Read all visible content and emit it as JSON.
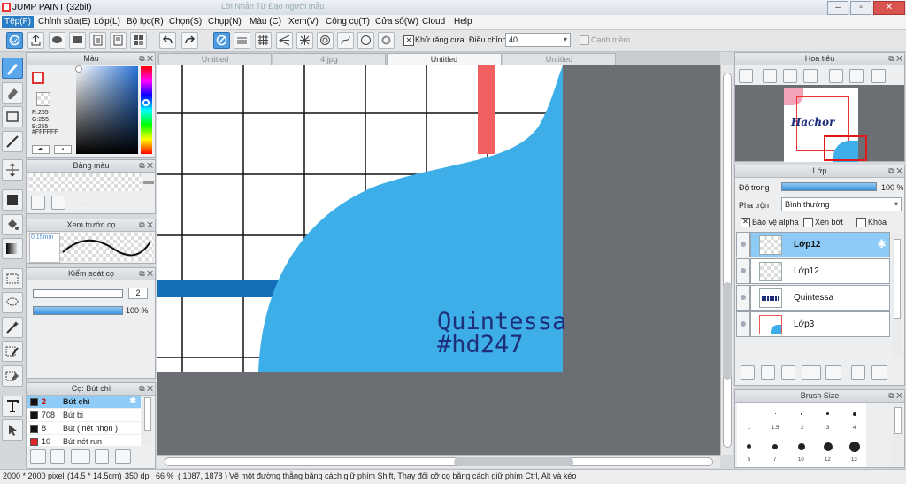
{
  "window": {
    "title": "JUMP PAINT (32bit)",
    "bg_tab_text": "Lời Nhắn Từ Đạo người mẫu"
  },
  "menu": [
    "Tệp(F)",
    "Chỉnh sửa(E)",
    "Lớp(L)",
    "Bộ lọc(R)",
    "Chọn(S)",
    "Chụp(N)",
    "Màu (C)",
    "Xem(V)",
    "Công cụ(T)",
    "Cửa sổ(W)",
    "Cloud",
    "Help"
  ],
  "toolbar": {
    "antialias_label": "Khử răng cưa",
    "correction_label": "Điều chỉnh",
    "correction_value": "40",
    "soft_label": "Cạnh mềm"
  },
  "color_panel": {
    "title": "Màu",
    "r": "R:255",
    "g": "G:255",
    "b": "B:255",
    "hex": "#FFFFFF"
  },
  "palette_panel": {
    "title": "Bảng màu",
    "empty": "---"
  },
  "brush_preview_panel": {
    "title": "Xem trước cọ",
    "size": "0.15mm"
  },
  "brush_control_panel": {
    "title": "Kiểm soát cọ",
    "size_value": "2",
    "opacity_value": "100 %",
    "opacity": 1.0
  },
  "brushes_panel": {
    "title": "Cọ: Bút chì",
    "items": [
      {
        "num": "2",
        "name": "Bút chì",
        "color": "#111111",
        "selected": true
      },
      {
        "num": "708",
        "name": "Bút bi",
        "color": "#111111",
        "selected": false
      },
      {
        "num": "8",
        "name": "Bút ( nét nhọn )",
        "color": "#111111",
        "selected": false
      },
      {
        "num": "10",
        "name": "Bút nét run",
        "color": "#e0242a",
        "selected": false
      }
    ]
  },
  "tabs": [
    "Untitled",
    "4.jpg",
    "Untitled",
    "Untitled"
  ],
  "canvas": {
    "line1": "Quintessa",
    "line2": "#hd247"
  },
  "navigator": {
    "title": "Hoa tiêu",
    "thumb_text": "Hachor"
  },
  "layer_panel": {
    "title": "Lớp",
    "opacity_label": "Độ trong",
    "opacity_value": "100 %",
    "opacity": 1.0,
    "blend_label": "Pha trộn",
    "blend_value": "Bình thường",
    "alpha_label": "Bảo vệ alpha",
    "clip_label": "Xén bớt",
    "lock_label": "Khóa",
    "layers": [
      {
        "name": "Lớp12",
        "selected": true
      },
      {
        "name": "Lớp12",
        "selected": false
      },
      {
        "name": "Quintessa",
        "selected": false
      },
      {
        "name": "Lớp3",
        "selected": false
      }
    ]
  },
  "brush_size_panel": {
    "title": "Brush Size",
    "row1": [
      "1",
      "1.5",
      "2",
      "3",
      "4"
    ],
    "row2": [
      "5",
      "7",
      "10",
      "12",
      "13"
    ]
  },
  "status": {
    "size": "2000 * 2000 pixel",
    "physical": "(14.5 * 14.5cm)",
    "dpi": "350 dpi",
    "zoom": "66 %",
    "coords": "( 1087, 1878 )",
    "hint": "Vẽ một đường thẳng bằng cách giữ phím Shift, Thay đổi cỡ cọ bằng cách giữ phím Ctrl, Alt và kéo"
  },
  "colors": {
    "accent": "#3daee8",
    "selection": "#8ecbf7",
    "canvas_gray": "#6b6e72",
    "text_navy": "#1e2e78",
    "red_stripe": "#f06060"
  }
}
